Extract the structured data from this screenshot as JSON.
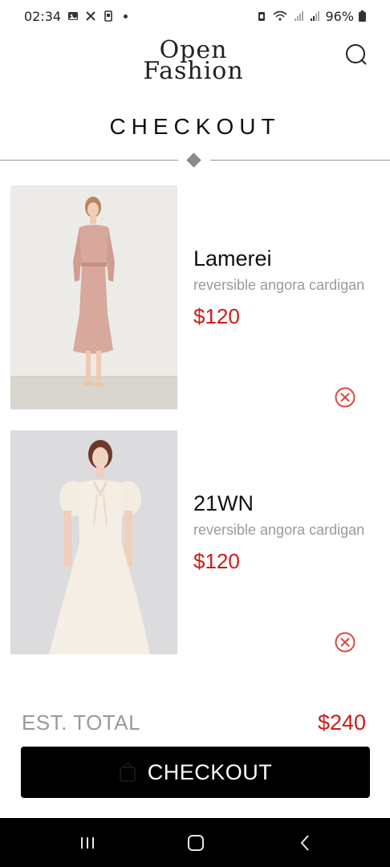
{
  "status_bar": {
    "time": "02:34",
    "battery": "96%"
  },
  "header": {
    "logo_line1": "Open",
    "logo_line2": "Fashion"
  },
  "page": {
    "title": "CHECKOUT"
  },
  "items": [
    {
      "brand": "Lamerei",
      "description": "reversible angora cardigan",
      "price": "$120"
    },
    {
      "brand": "21WN",
      "description": "reversible angora cardigan",
      "price": "$120"
    }
  ],
  "summary": {
    "total_label": "EST. TOTAL",
    "total_value": "$240",
    "checkout_label": "CHECKOUT"
  },
  "colors": {
    "accent_price": "#d11a1a",
    "button_bg": "#000000",
    "muted_text": "#9a9a9a"
  },
  "icons": {
    "search": "search-icon",
    "remove": "remove-circle-icon",
    "bag": "shopping-bag-icon",
    "nav_recent": "recent-apps-icon",
    "nav_home": "home-icon",
    "nav_back": "back-icon"
  }
}
